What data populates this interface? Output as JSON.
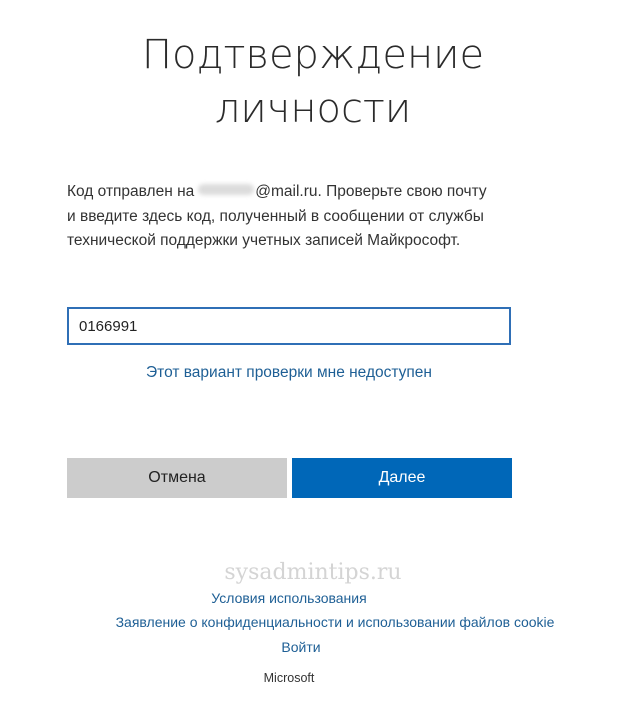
{
  "title": {
    "line1": "Подтверждение",
    "line2": "личности"
  },
  "description": {
    "prefix": "Код отправлен на",
    "email_domain": "@mail.ru",
    "suffix": ". Проверьте свою почту и введите здесь код, полученный в сообщении от службы технической поддержки учетных записей Майкрософт."
  },
  "code_input": {
    "value": "0166991"
  },
  "alt_link": "Этот вариант проверки мне недоступен",
  "buttons": {
    "cancel": "Отмена",
    "next": "Далее"
  },
  "watermark": "sysadmintips.ru",
  "footer": {
    "terms": "Условия использования",
    "privacy": "Заявление о конфиденциальности и использовании файлов cookie",
    "signin": "Войти",
    "brand": "Microsoft"
  },
  "colors": {
    "accent": "#0067b8",
    "link": "#1e5f95",
    "cancel_bg": "#cccccc",
    "input_border": "#2f6fb6"
  }
}
